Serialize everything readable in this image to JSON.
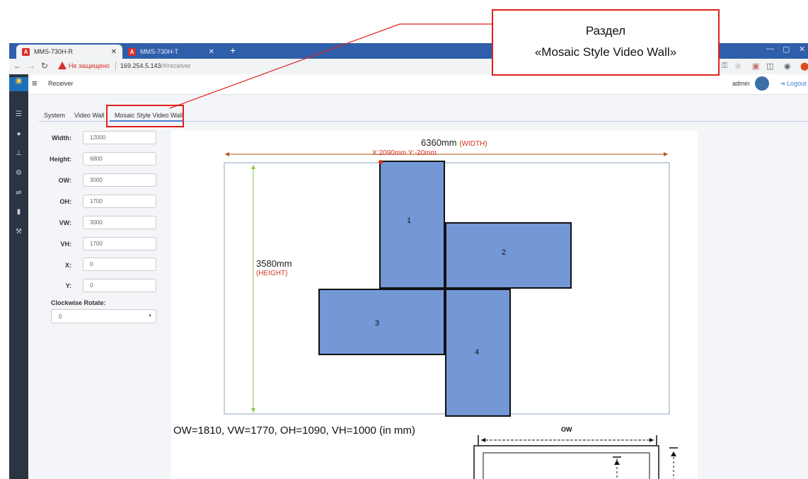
{
  "browser": {
    "tabs": [
      {
        "title": "MMS-730H-R",
        "active": true
      },
      {
        "title": "MMS-730H-T",
        "active": false
      }
    ],
    "warning_text": "Не защищено",
    "url_host": "169.254.5.143",
    "url_path": "/#/receiver"
  },
  "annotation": {
    "line1": "Раздел",
    "line2": "«Mosaic Style Video Wall»",
    "color": "#e0201a"
  },
  "app": {
    "page_title": "Receiver",
    "user": "admin",
    "logout_label": "Logout",
    "tabs": [
      "System",
      "Video Wall",
      "Mosaic Style Video Wall"
    ],
    "active_tab": "Mosaic Style Video Wall",
    "left_nav_icons": [
      "grid-icon",
      "user-icon",
      "sitemap-icon",
      "gear-icon",
      "usb-icon",
      "database-icon",
      "wrench-icon"
    ]
  },
  "form": {
    "fields": [
      {
        "label": "Width:",
        "value": "12000"
      },
      {
        "label": "Height:",
        "value": "6800"
      },
      {
        "label": "OW:",
        "value": "3000"
      },
      {
        "label": "OH:",
        "value": "1700"
      },
      {
        "label": "VW:",
        "value": "3000"
      },
      {
        "label": "VH:",
        "value": "1700"
      },
      {
        "label": "X:",
        "value": "0"
      },
      {
        "label": "Y:",
        "value": "0"
      }
    ],
    "rotate_label": "Clockwise Rotate:",
    "rotate_value": "0"
  },
  "diagram": {
    "width_text": "6360mm",
    "width_tag": "(WIDTH)",
    "height_text": "3580mm",
    "height_tag": "(HEIGHT)",
    "position_text": "X:2090mm Y:-20mm",
    "screens": [
      "1",
      "2",
      "3",
      "4"
    ],
    "caption": "OW=1810, VW=1770, OH=1090, VH=1000 (in mm)",
    "ow_label": "OW",
    "screen_fill": "#7497d6",
    "arrow_color": "#b3521f",
    "height_arrow_color": "#8bc34a"
  }
}
